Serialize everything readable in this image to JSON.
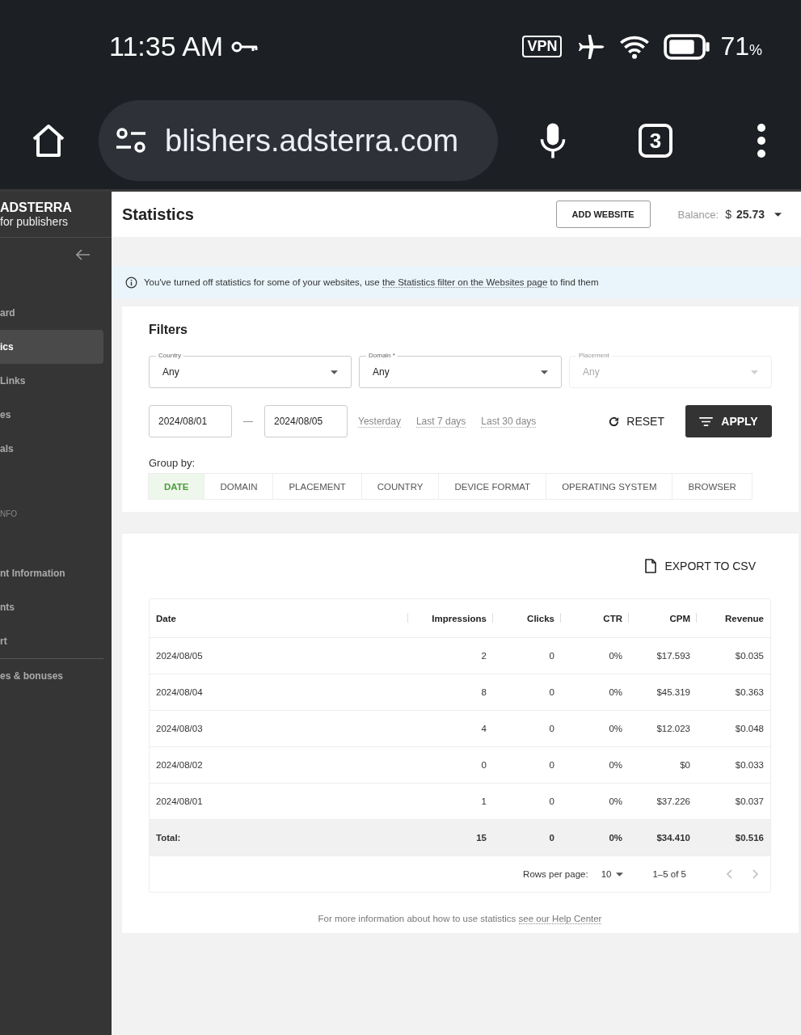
{
  "status_bar": {
    "time": "11:35 AM",
    "vpn": "VPN",
    "battery": "71",
    "battery_unit": "%"
  },
  "browser": {
    "url": "blishers.adsterra.com",
    "tab_count": "3"
  },
  "sidebar": {
    "brand": "ADSTERRA",
    "tagline": "for publishers",
    "items": [
      {
        "label": "ard",
        "selected": false
      },
      {
        "label": "ics",
        "selected": true
      },
      {
        "label": "Links",
        "selected": false
      },
      {
        "label": "es",
        "selected": false
      },
      {
        "label": "als",
        "selected": false
      }
    ],
    "section": {
      "title": "NFO",
      "items": [
        {
          "label": "nt Information",
          "selected": false
        },
        {
          "label": "nts",
          "selected": false
        },
        {
          "label": "rt",
          "selected": false
        }
      ]
    },
    "bottom_items": [
      {
        "label": "es & bonuses",
        "selected": false
      }
    ]
  },
  "header": {
    "title": "Statistics",
    "add_button": "ADD WEBSITE",
    "balance_label": "Balance:",
    "currency": "$",
    "balance": "25.73"
  },
  "notice": {
    "before": "You've turned off statistics for some of your websites, use ",
    "link": "the Statistics filter on the Websites page",
    "after": " to find them"
  },
  "filters": {
    "title": "Filters",
    "selects": [
      {
        "label": "Country",
        "value": "Any",
        "disabled": false
      },
      {
        "label": "Domain *",
        "value": "Any",
        "disabled": false
      },
      {
        "label": "Placement",
        "placeholder": "Any",
        "disabled": true
      }
    ],
    "date_from": "2024/08/01",
    "separator": "—",
    "date_to": "2024/08/05",
    "presets": [
      "Yesterday",
      "Last 7 days",
      "Last 30 days"
    ],
    "reset": "RESET",
    "apply": "APPLY",
    "group_by_label": "Group by:",
    "group_by": [
      {
        "label": "DATE",
        "selected": true
      },
      {
        "label": "DOMAIN",
        "selected": false
      },
      {
        "label": "PLACEMENT",
        "selected": false
      },
      {
        "label": "COUNTRY",
        "selected": false
      },
      {
        "label": "DEVICE FORMAT",
        "selected": false
      },
      {
        "label": "OPERATING SYSTEM",
        "selected": false
      },
      {
        "label": "BROWSER",
        "selected": false
      }
    ]
  },
  "report": {
    "export": "EXPORT TO CSV",
    "table": {
      "columns": [
        "Date",
        "Impressions",
        "Clicks",
        "CTR",
        "CPM",
        "Revenue"
      ],
      "rows": [
        [
          "2024/08/05",
          "2",
          "0",
          "0%",
          "$17.593",
          "$0.035"
        ],
        [
          "2024/08/04",
          "8",
          "0",
          "0%",
          "$45.319",
          "$0.363"
        ],
        [
          "2024/08/03",
          "4",
          "0",
          "0%",
          "$12.023",
          "$0.048"
        ],
        [
          "2024/08/02",
          "0",
          "0",
          "0%",
          "$0",
          "$0.033"
        ],
        [
          "2024/08/01",
          "1",
          "0",
          "0%",
          "$37.226",
          "$0.037"
        ]
      ],
      "total": [
        "Total:",
        "15",
        "0",
        "0%",
        "$34.410",
        "$0.516"
      ]
    },
    "rows_per_page_label": "Rows per page:",
    "rows_per_page": "10",
    "range": "1–5 of 5",
    "footer": {
      "before": "For more information about how to use statistics ",
      "link": "see our Help Center"
    }
  }
}
